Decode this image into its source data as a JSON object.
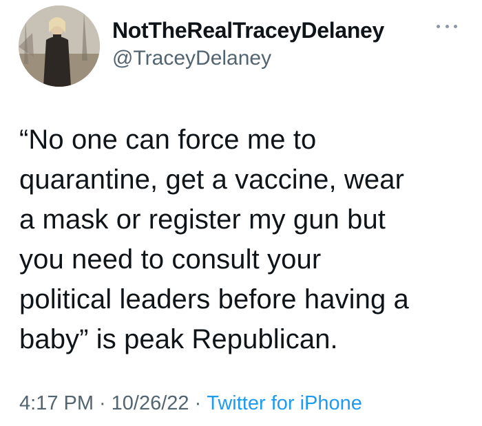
{
  "tweet": {
    "author": {
      "display_name": "NotTheRealTraceyDelaney",
      "handle": "@TraceyDelaney",
      "avatar": "profile-photo"
    },
    "more_icon": "more-horizontal-icon",
    "text": "“No one can force me to\nquarantine, get a vaccine, wear\na mask or register my gun but\nyou need to consult your\npolitical leaders before having a\nbaby” is peak Republican.",
    "time": "4:17 PM",
    "date": "10/26/22",
    "separator": "·",
    "source": "Twitter for iPhone"
  },
  "colors": {
    "text": "#0f1419",
    "secondary": "#536471",
    "link": "#1d9bf0"
  }
}
